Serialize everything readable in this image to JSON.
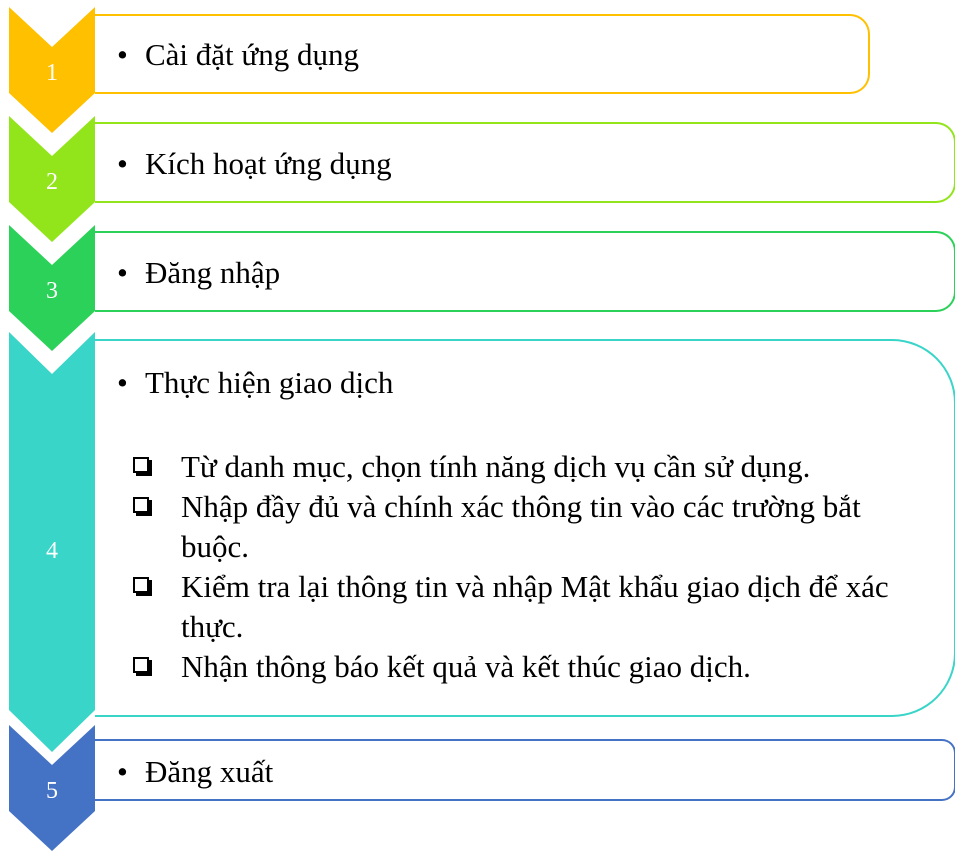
{
  "steps": [
    {
      "number": "1",
      "label": "Cài đặt ứng dụng",
      "color": "#ffc000"
    },
    {
      "number": "2",
      "label": "Kích hoạt ứng dụng",
      "color": "#92e51a"
    },
    {
      "number": "3",
      "label": "Đăng nhập",
      "color": "#2bd158"
    },
    {
      "number": "4",
      "label": "Thực hiện giao dịch",
      "color": "#39d5c8",
      "sub_items": [
        "Từ danh mục, chọn tính năng dịch vụ cần sử dụng.",
        "Nhập đầy đủ và chính xác thông tin vào các trường bắt buộc.",
        "Kiểm tra lại thông tin và nhập Mật khẩu giao dịch để xác thực.",
        "Nhận thông báo kết quả và kết thúc giao dịch."
      ]
    },
    {
      "number": "5",
      "label": "Đăng xuất",
      "color": "#4472c4"
    }
  ],
  "bullet_symbol": "•"
}
